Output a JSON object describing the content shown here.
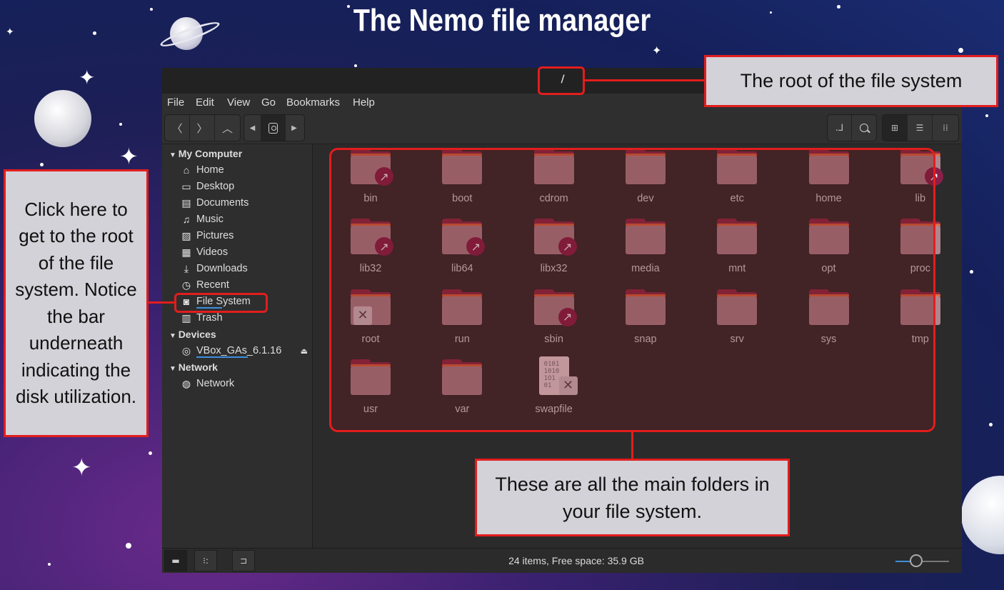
{
  "slide_title": "The Nemo file manager",
  "window": {
    "path_title": "/",
    "menu": [
      "File",
      "Edit",
      "View",
      "Go",
      "Bookmarks",
      "Help"
    ],
    "toolbar": {
      "back_icon": "chevron-left-icon",
      "forward_icon": "chevron-right-icon",
      "up_icon": "chevron-up-icon",
      "breadcrumb_prev": "triangle-left-icon",
      "breadcrumb_root": "disk-icon",
      "breadcrumb_next": "triangle-right-icon",
      "path_toggle_icon": "path-edit-icon",
      "search_icon": "search-icon",
      "view_icons": [
        "icon-view-icon",
        "list-view-icon",
        "compact-view-icon"
      ]
    },
    "sidebar": {
      "sections": [
        {
          "title": "My Computer",
          "items": [
            {
              "label": "Home",
              "icon": "home-icon",
              "glyph": "⌂"
            },
            {
              "label": "Desktop",
              "icon": "desktop-icon",
              "glyph": "▭"
            },
            {
              "label": "Documents",
              "icon": "documents-icon",
              "glyph": "▤"
            },
            {
              "label": "Music",
              "icon": "music-icon",
              "glyph": "♫"
            },
            {
              "label": "Pictures",
              "icon": "pictures-icon",
              "glyph": "▨"
            },
            {
              "label": "Videos",
              "icon": "videos-icon",
              "glyph": "▦"
            },
            {
              "label": "Downloads",
              "icon": "download-icon",
              "glyph": "⤓"
            },
            {
              "label": "Recent",
              "icon": "recent-icon",
              "glyph": "◷"
            },
            {
              "label": "File System",
              "icon": "file-system-icon",
              "glyph": "◙"
            },
            {
              "label": "Trash",
              "icon": "trash-icon",
              "glyph": "▥"
            }
          ]
        },
        {
          "title": "Devices",
          "items": [
            {
              "label": "VBox_GAs_6.1.16",
              "icon": "disc-icon",
              "glyph": "◎"
            }
          ]
        },
        {
          "title": "Network",
          "items": [
            {
              "label": "Network",
              "icon": "network-icon",
              "glyph": "◍"
            }
          ]
        }
      ]
    },
    "items": [
      {
        "name": "bin",
        "kind": "folder",
        "emblem": "link"
      },
      {
        "name": "boot",
        "kind": "folder",
        "emblem": ""
      },
      {
        "name": "cdrom",
        "kind": "folder",
        "emblem": ""
      },
      {
        "name": "dev",
        "kind": "folder",
        "emblem": ""
      },
      {
        "name": "etc",
        "kind": "folder",
        "emblem": ""
      },
      {
        "name": "home",
        "kind": "folder",
        "emblem": ""
      },
      {
        "name": "lib",
        "kind": "folder",
        "emblem": "link"
      },
      {
        "name": "lib32",
        "kind": "folder",
        "emblem": "link"
      },
      {
        "name": "lib64",
        "kind": "folder",
        "emblem": "link"
      },
      {
        "name": "libx32",
        "kind": "folder",
        "emblem": "link"
      },
      {
        "name": "media",
        "kind": "folder",
        "emblem": ""
      },
      {
        "name": "mnt",
        "kind": "folder",
        "emblem": ""
      },
      {
        "name": "opt",
        "kind": "folder",
        "emblem": ""
      },
      {
        "name": "proc",
        "kind": "folder",
        "emblem": ""
      },
      {
        "name": "root",
        "kind": "folder",
        "emblem": "locked"
      },
      {
        "name": "run",
        "kind": "folder",
        "emblem": ""
      },
      {
        "name": "sbin",
        "kind": "folder",
        "emblem": "link"
      },
      {
        "name": "snap",
        "kind": "folder",
        "emblem": ""
      },
      {
        "name": "srv",
        "kind": "folder",
        "emblem": ""
      },
      {
        "name": "sys",
        "kind": "folder",
        "emblem": ""
      },
      {
        "name": "tmp",
        "kind": "folder",
        "emblem": ""
      },
      {
        "name": "usr",
        "kind": "folder",
        "emblem": ""
      },
      {
        "name": "var",
        "kind": "folder",
        "emblem": ""
      },
      {
        "name": "swapfile",
        "kind": "binary-file",
        "emblem": "locked"
      }
    ],
    "status": {
      "text": "24 items, Free space: 35.9 GB",
      "zoom_level": 0.38
    }
  },
  "callouts": {
    "root": "The root of the file system",
    "sidebar": "Click here to get to the root of the file system. Notice the bar underneath indicating the disk utilization.",
    "folders": "These are all the main folders in your file system."
  },
  "colors": {
    "highlight": "#e21d1d",
    "folder_body": "#8f2a46",
    "folder_stripe": "#e0683c",
    "accent": "#3e8edc"
  }
}
